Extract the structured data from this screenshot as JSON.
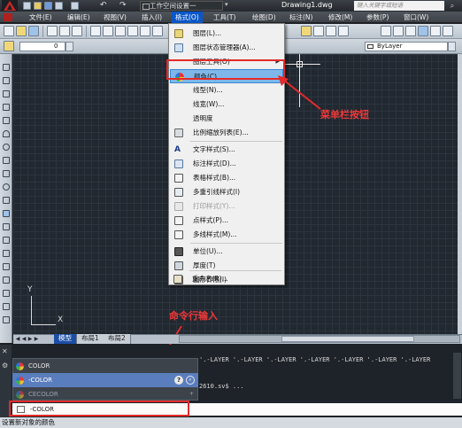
{
  "titlebar": {
    "workspace": "工作空间设置一",
    "document": "Drawing1.dwg",
    "search_placeholder": "键入关键字或短语"
  },
  "menubar": {
    "items": [
      {
        "label": "文件(E)"
      },
      {
        "label": "编辑(E)"
      },
      {
        "label": "视图(V)"
      },
      {
        "label": "插入(I)"
      },
      {
        "label": "格式(O)"
      },
      {
        "label": "工具(T)"
      },
      {
        "label": "绘图(D)"
      },
      {
        "label": "标注(N)"
      },
      {
        "label": "修改(M)"
      },
      {
        "label": "参数(P)"
      },
      {
        "label": "窗口(W)"
      }
    ]
  },
  "toolbar": {
    "layer_value": "0",
    "color_value": "ByLayer"
  },
  "format_menu": {
    "items": [
      {
        "label": "图层(L)..."
      },
      {
        "label": "图层状态管理器(A)..."
      },
      {
        "label": "图层工具(O)",
        "submenu": "▶"
      },
      {
        "label": "颜色(C)..."
      },
      {
        "label": "线型(N)..."
      },
      {
        "label": "线宽(W)..."
      },
      {
        "label": "透明度"
      },
      {
        "label": "比例缩放列表(E)..."
      },
      {
        "label": "文字样式(S)..."
      },
      {
        "label": "标注样式(D)..."
      },
      {
        "label": "表格样式(B)..."
      },
      {
        "label": "多重引线样式(I)"
      },
      {
        "label": "打印样式(Y)..."
      },
      {
        "label": "点样式(P)..."
      },
      {
        "label": "多线样式(M)..."
      },
      {
        "label": "单位(U)..."
      },
      {
        "label": "厚度(T)"
      },
      {
        "label": "图形界限(I)"
      },
      {
        "label": "重命名(R)..."
      }
    ]
  },
  "annotations": {
    "menu_button": "菜单栏按钮",
    "command_input": "命令行输入"
  },
  "canvas": {
    "ucs_y": "Y",
    "ucs_x": "X"
  },
  "layout_tabs": {
    "nav_first": "◀",
    "nav_prev": "◀",
    "nav_next": "▶",
    "nav_last": "▶",
    "tabs": [
      "模型",
      "布局1",
      "布局2"
    ]
  },
  "command": {
    "history_line": "'.-LAYER '.-LAYER '.-LAYER '.-LAYER '.-LAYER '.-LAYER '.-LAYER",
    "history_line2": "2610.sv$ ...",
    "autocomplete": [
      "COLOR",
      "-COLOR",
      "CECOLOR"
    ],
    "input_value": "-COLOR",
    "help": "?",
    "search": "⌕",
    "expand": "+"
  },
  "statusbar": {
    "text": "设置新对象的颜色"
  },
  "colors": {
    "highlight": "#7fb7ea",
    "annotation_red": "#e42a2a",
    "menu_active": "#0b57c9"
  }
}
